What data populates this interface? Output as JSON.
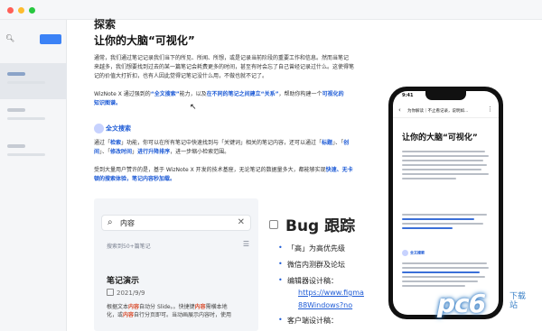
{
  "doc": {
    "heading_cut": "探索",
    "heading": "让你的大脑“可视化”",
    "para1_line1": "通常，我们通过笔记记录我们当下的所见、所闻、所想，或是记录当前阶段的重要工作和信息。然而当笔记",
    "para1_line2": "来越多，我们想要找到过去的某一篇笔记会耗费更多的时间，甚至有时会忘了自己曾经记录过什么。这使得笔",
    "para1_line3": "记的价值大打折扣，也有人因此觉得记笔记没什么用，不做也就不记了。",
    "para2_pre": "WizNote X 通过强到的",
    "para2_b1": "“全文搜索”",
    "para2_mid": "能力，以及",
    "para2_b2": "在不同的笔记之间建立“关系”",
    "para2_post": "，帮助你构建一个",
    "para2_b3": "可视化的",
    "para2_line2": "知识图谱。",
    "sub_heading": "全文搜索",
    "para3_pre": "通过「",
    "para3_b1": "检索",
    "para3_mid": "」功能，你可以在所有笔记中快速找到与「关键词」相关的笔记内容，还可以通过「",
    "para3_b2": "标题",
    "para3_tail": "」、「",
    "para3_b3": "创",
    "para3_line2_b1": "间",
    "para3_line2_mid1": "」、「",
    "para3_line2_b2": "修改时间",
    "para3_line2_mid2": "」",
    "para3_line2_b3": "进行升降排序",
    "para3_line2_post": "，进一步缩小检索范围。",
    "para4_pre": "受到大量用户赞许的是，基于 WizNote X 开发的技术基座，无论笔记的数据量多大，都能够实现",
    "para4_b1": "快速、无卡",
    "para4_line2": "顿的搜索体验，笔记内容秒加载。"
  },
  "search_shot": {
    "query": "内容",
    "count": "搜索到50+篇笔记",
    "note_title": "笔记演示",
    "note_date": "2021/9/9",
    "snip1_pre": "根据文本",
    "snip1_hl1": "内容",
    "snip1_mid": "自动分 Slide。。快捷键",
    "snip1_hl2": "内容",
    "snip1_post": "需横本地",
    "snip2_pre": "化，或",
    "snip2_hl": "内容",
    "snip2_post": "自行分页即可。当动画展示内容时，使用"
  },
  "bug": {
    "title": "Bug 跟踪",
    "item1": "「高」为高优先级",
    "item2": "微信内测群及论坛",
    "item3": "编辑器设计稿：",
    "link1": "https://www.figma",
    "link2": "88Windows?no",
    "item4": "客户端设计稿："
  },
  "phone": {
    "time": "9:41",
    "bar_title": "为你解读｜不止看记录，说明如...",
    "heading": "让你的大脑“可视化”",
    "sub_heading": "全文搜索"
  },
  "watermark": {
    "logo": "pc6",
    "text": "下载站"
  }
}
